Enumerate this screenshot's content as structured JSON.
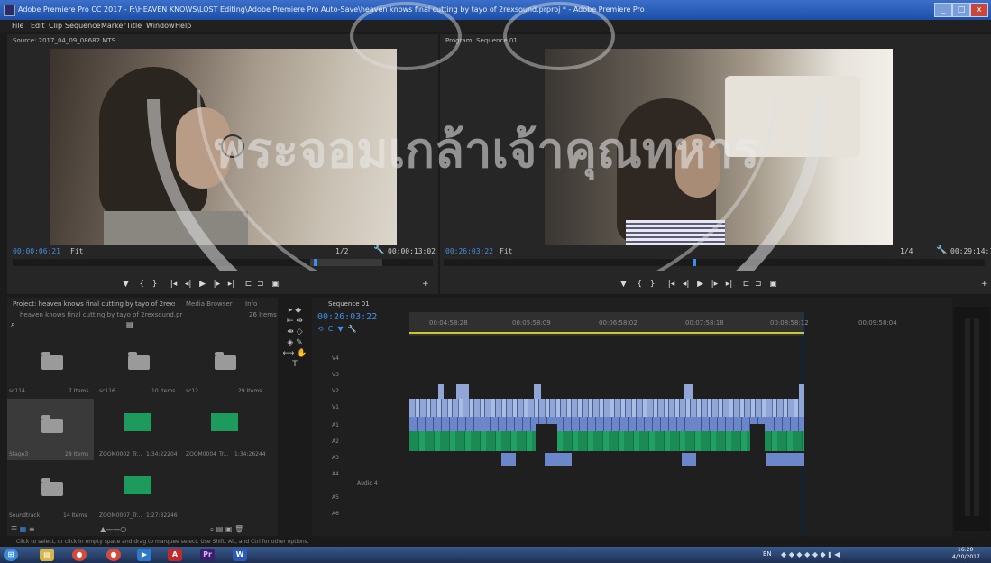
{
  "window": {
    "title": "Adobe Premiere Pro CC 2017 - F:\\HEAVEN KNOWS\\LOST Editing\\Adobe Premiere Pro Auto-Save\\heaven knows final cutting by tayo of 2rexsound.prproj * - Adobe Premiere Pro",
    "controls": [
      "_",
      "□",
      "x"
    ]
  },
  "menu": [
    "File",
    "Edit",
    "Clip",
    "Sequence",
    "Marker",
    "Title",
    "Window",
    "Help"
  ],
  "source_monitor": {
    "tab": "Source: 2017_04_09_08682.MTS",
    "timecode_left": "00:00:06:21",
    "fit": "Fit",
    "zoom": "1/2",
    "timecode_right": "00:00:13:02"
  },
  "program_monitor": {
    "tab": "Program: Sequence 01",
    "timecode_left": "00:26:03:22",
    "fit": "Fit",
    "zoom": "1/4",
    "timecode_right": "00:29:14:10"
  },
  "transport_icons": [
    "marker-icon",
    "in-point-icon",
    "out-point-icon",
    "go-to-in-icon",
    "step-back-icon",
    "play-icon",
    "step-forward-icon",
    "go-to-out-icon",
    "insert-icon",
    "overwrite-icon",
    "export-frame-icon"
  ],
  "project_panel": {
    "tab": "Project: heaven knows final cutting by tayo of 2rexsound",
    "tab2": "Media Browser",
    "tab3": "Info",
    "path": "heaven knows final cutting by tayo of 2rexsound.prproj",
    "item_count": "26 Items",
    "items": [
      {
        "name": "sc114",
        "meta": "7 Items",
        "kind": "folder"
      },
      {
        "name": "sc116",
        "meta": "10 Items",
        "kind": "folder"
      },
      {
        "name": "sc12",
        "meta": "29 Items",
        "kind": "folder"
      },
      {
        "name": "Stage3",
        "meta": "28 Items",
        "kind": "folder"
      },
      {
        "name": "ZOOM0002_Tr...",
        "meta": "1:34:22204",
        "kind": "audio"
      },
      {
        "name": "ZOOM0004_Tr...",
        "meta": "1:34:26244",
        "kind": "audio"
      },
      {
        "name": "Soundtrack",
        "meta": "14 Items",
        "kind": "folder"
      },
      {
        "name": "ZOOM0007_Tr...",
        "meta": "1:27:32246",
        "kind": "audio"
      }
    ]
  },
  "timeline": {
    "tab": "Sequence 01",
    "timecode": "00:26:03:22",
    "ruler": [
      "00:04:58:28",
      "00:05:58:09",
      "00:06:58:02",
      "00:07:58:18",
      "00:08:58:12",
      "00:09:58:04"
    ],
    "tracks": [
      "V4",
      "V3",
      "V2",
      "V1",
      "A1",
      "A2",
      "A3",
      "A4",
      "A5",
      "A6"
    ],
    "audio4_name": "Audio 4"
  },
  "status": "Click to select, or click in empty space and drag to marquee select. Use Shift, Alt, and Ctrl for other options.",
  "taskbar": {
    "apps": [
      "start-orb",
      "explorer",
      "chrome",
      "chrome-2",
      "media",
      "acrobat",
      "premiere",
      "word"
    ],
    "clock_time": "16:20",
    "clock_date": "4/20/2017",
    "lang": "EN"
  },
  "watermark_text": "พระจอมเกล้าเจ้าคุณทหาร",
  "colors": {
    "timecode": "#3e8ee8",
    "audio_clip": "#1c8a55",
    "video_clip": "#8fa6d6",
    "titlebar": "#1d4fa8"
  }
}
